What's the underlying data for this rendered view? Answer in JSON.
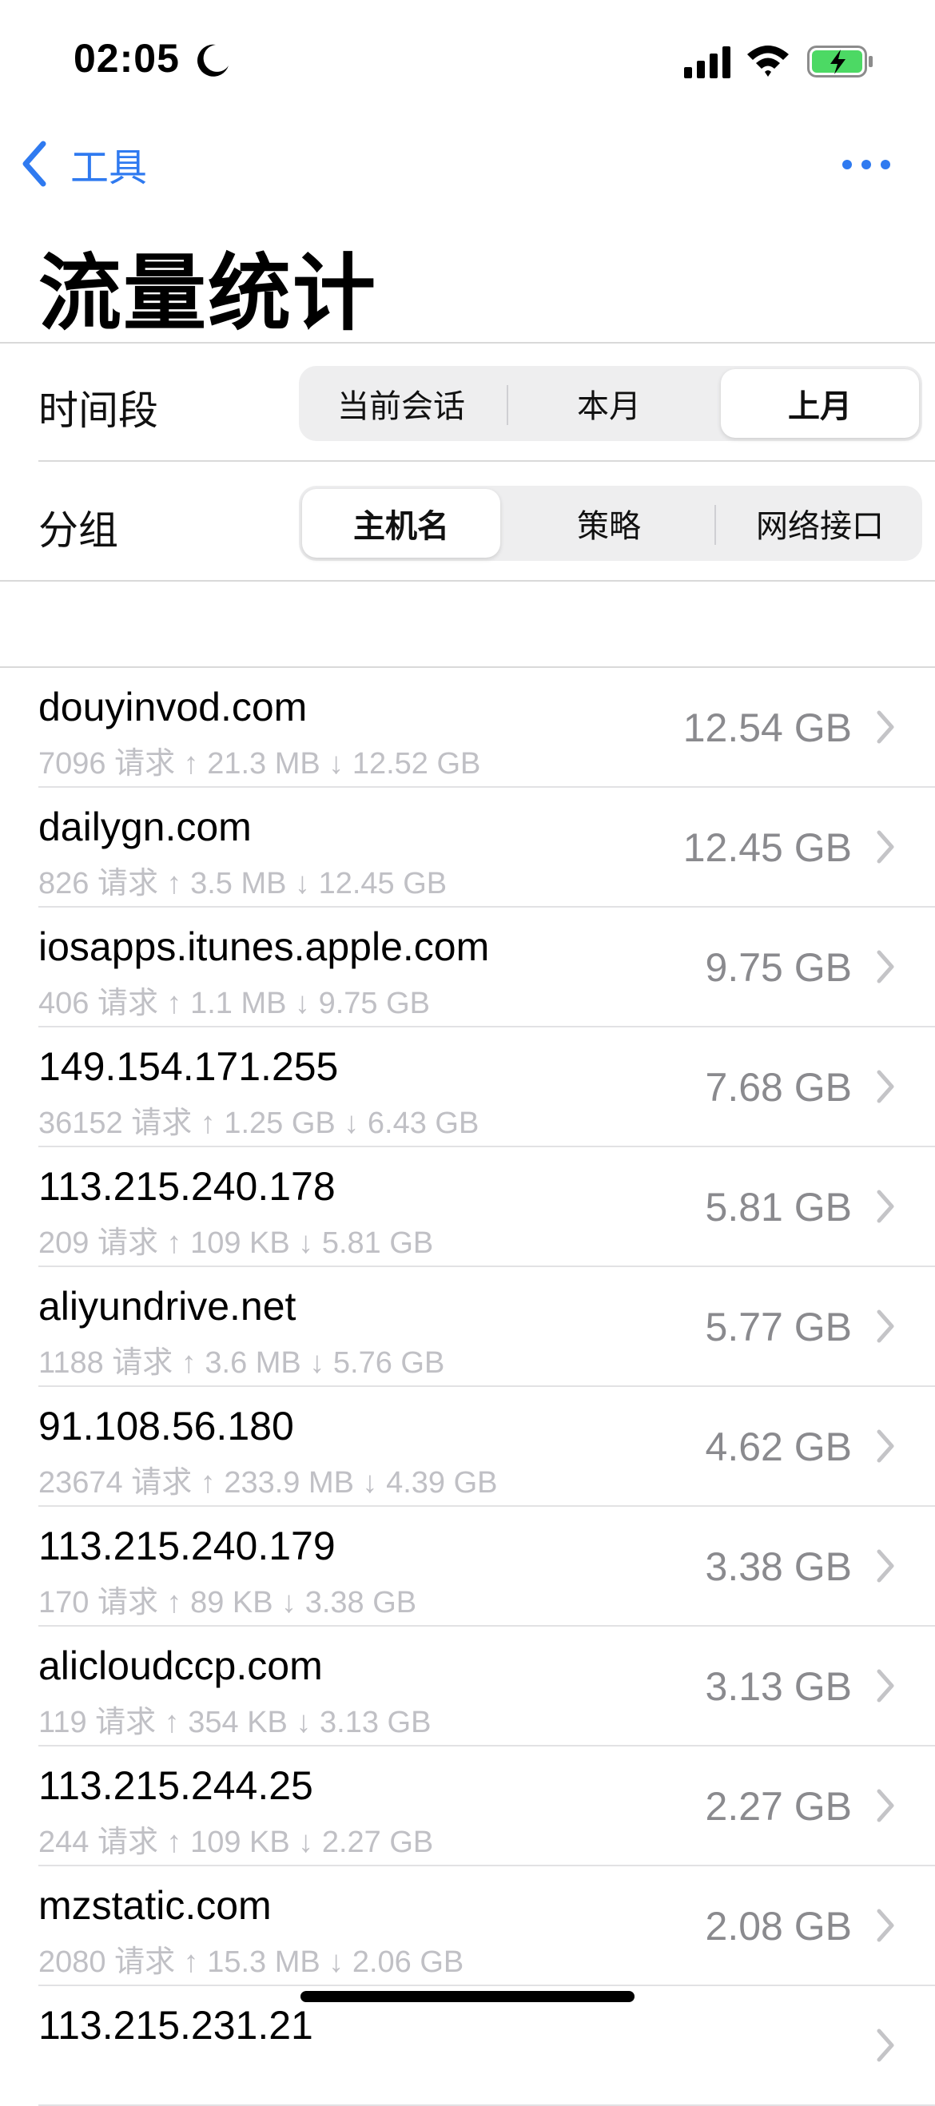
{
  "status_bar": {
    "time": "02:05"
  },
  "nav": {
    "back_label": "工具",
    "title": "流量统计"
  },
  "time_period": {
    "label": "时间段",
    "options": [
      "当前会话",
      "本月",
      "上月"
    ],
    "selected": "上月"
  },
  "grouping": {
    "label": "分组",
    "options": [
      "主机名",
      "策略",
      "网络接口"
    ],
    "selected": "主机名"
  },
  "hosts": [
    {
      "host": "douyinvod.com",
      "meta": "7096 请求 ↑ 21.3 MB ↓ 12.52 GB",
      "total": "12.54 GB"
    },
    {
      "host": "dailygn.com",
      "meta": "826 请求 ↑ 3.5 MB ↓ 12.45 GB",
      "total": "12.45 GB"
    },
    {
      "host": "iosapps.itunes.apple.com",
      "meta": "406 请求 ↑ 1.1 MB ↓ 9.75 GB",
      "total": "9.75 GB"
    },
    {
      "host": "149.154.171.255",
      "meta": "36152 请求 ↑ 1.25 GB ↓ 6.43 GB",
      "total": "7.68 GB"
    },
    {
      "host": "113.215.240.178",
      "meta": "209 请求 ↑ 109 KB ↓ 5.81 GB",
      "total": "5.81 GB"
    },
    {
      "host": "aliyundrive.net",
      "meta": "1188 请求 ↑ 3.6 MB ↓ 5.76 GB",
      "total": "5.77 GB"
    },
    {
      "host": "91.108.56.180",
      "meta": "23674 请求 ↑ 233.9 MB ↓ 4.39 GB",
      "total": "4.62 GB"
    },
    {
      "host": "113.215.240.179",
      "meta": "170 请求 ↑ 89 KB ↓ 3.38 GB",
      "total": "3.38 GB"
    },
    {
      "host": "alicloudccp.com",
      "meta": "119 请求 ↑ 354 KB ↓ 3.13 GB",
      "total": "3.13 GB"
    },
    {
      "host": "113.215.244.25",
      "meta": "244 请求 ↑ 109 KB ↓ 2.27 GB",
      "total": "2.27 GB"
    },
    {
      "host": "mzstatic.com",
      "meta": "2080 请求 ↑ 15.3 MB ↓ 2.06 GB",
      "total": "2.08 GB"
    },
    {
      "host": "113.215.231.21",
      "meta": "",
      "total": ""
    }
  ],
  "colors": {
    "accent": "#2f7af0",
    "battery": "#4cd964"
  }
}
